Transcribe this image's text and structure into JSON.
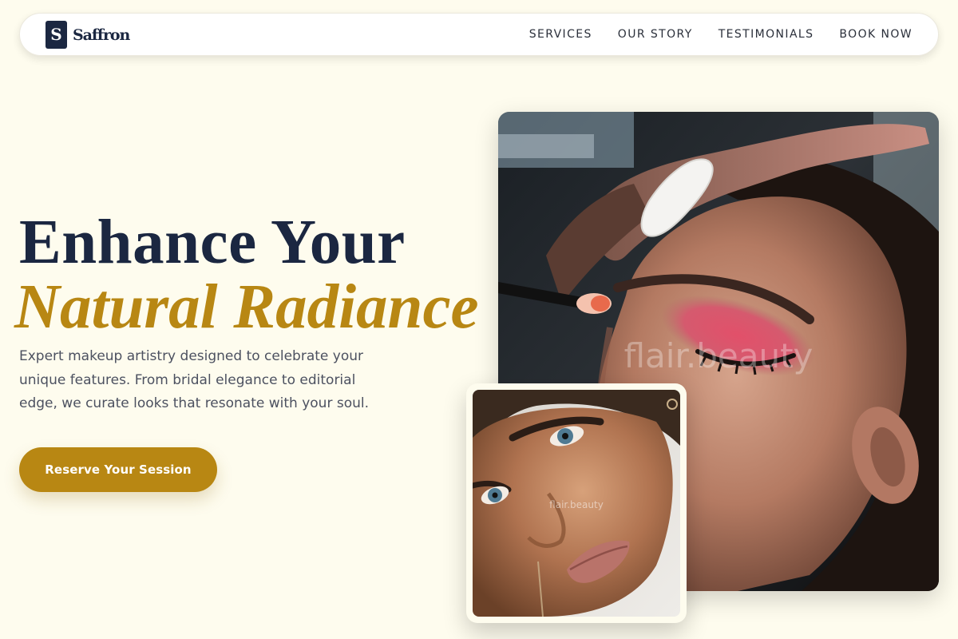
{
  "brand": {
    "mark": "S",
    "name": "Saffron"
  },
  "nav": {
    "items": [
      {
        "label": "SERVICES"
      },
      {
        "label": "OUR STORY"
      },
      {
        "label": "TESTIMONIALS"
      },
      {
        "label": "BOOK NOW"
      }
    ]
  },
  "hero": {
    "title_line1": "Enhance Your",
    "title_line2": "Natural Radiance",
    "description": "Expert makeup artistry designed to celebrate your unique features. From bridal elegance to editorial edge, we curate looks that resonate with your soul.",
    "cta_label": "Reserve Your Session"
  },
  "images": {
    "main_watermark": "flair.beauty",
    "small_watermark": "flair.beauty"
  },
  "colors": {
    "background": "#fefcee",
    "navy": "#1b2741",
    "gold": "#b88713",
    "body_text": "#4c5160"
  }
}
